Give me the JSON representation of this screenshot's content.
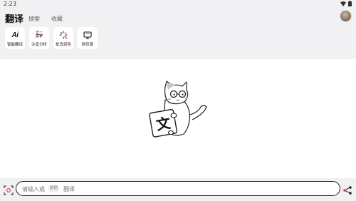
{
  "status": {
    "time": "2:23"
  },
  "header": {
    "title": "翻译",
    "tabs": [
      {
        "label": "搜索"
      },
      {
        "label": "收藏"
      }
    ]
  },
  "tools": [
    {
      "label": "智能翻译",
      "icon": "ai-translate-icon",
      "glyph": "Ai"
    },
    {
      "label": "注音分析",
      "icon": "phonetic-doc-icon",
      "glyph_top": "ㄊㄧ",
      "glyph_bottom": "文字"
    },
    {
      "label": "批改润色",
      "icon": "sparkle-brush-icon"
    },
    {
      "label": "网页版",
      "icon": "monitor-icon"
    }
  ],
  "illustration": {
    "sign_char": "文"
  },
  "input": {
    "placeholder_prefix": "请输入或",
    "paste_chip": "粘贴",
    "placeholder_suffix": "翻译"
  },
  "colors": {
    "accent_red": "#d9363e",
    "background_gray": "#f1f1f3"
  }
}
